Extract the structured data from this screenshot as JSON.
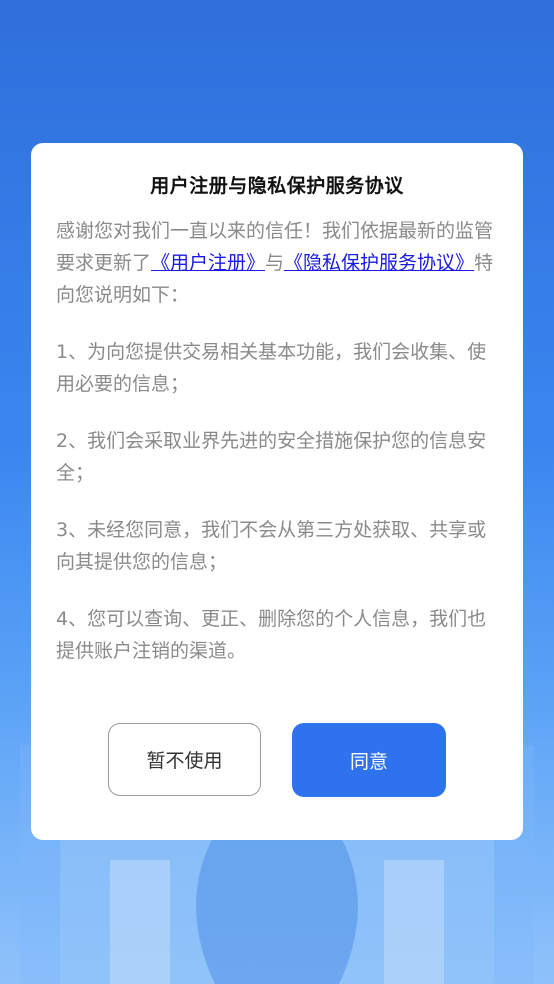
{
  "colors": {
    "accent": "#2f72ee",
    "link": "#1a1ae6",
    "body_text": "#8a8a8a",
    "title_text": "#111111",
    "background_top": "#2f6fdc",
    "background_bottom": "#8fc2fb"
  },
  "dialog": {
    "title": "用户注册与隐私保护服务协议",
    "intro": {
      "prefix": "感谢您对我们一直以来的信任！我们依据最新的监管要求更新了",
      "link_registration": "《用户注册》",
      "connector": "与",
      "link_privacy": "《隐私保护服务协议》",
      "suffix": "特向您说明如下："
    },
    "items": [
      "1、为向您提供交易相关基本功能，我们会收集、使用必要的信息；",
      "2、我们会采取业界先进的安全措施保护您的信息安全；",
      "3、未经您同意，我们不会从第三方处获取、共享或向其提供您的信息；",
      "4、您可以查询、更正、删除您的个人信息，我们也提供账户注销的渠道。"
    ],
    "buttons": {
      "decline_label": "暂不使用",
      "agree_label": "同意"
    }
  }
}
